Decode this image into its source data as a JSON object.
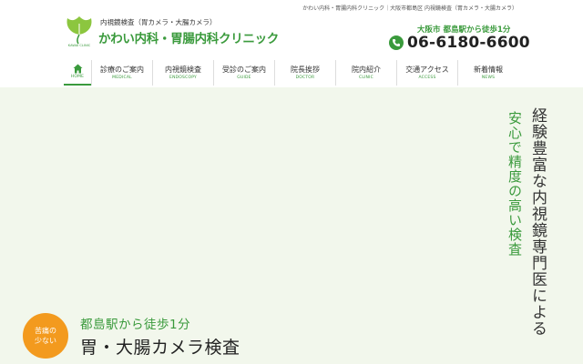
{
  "topbar": {
    "text": "かわい内科・胃腸内科クリニック｜大阪市都島区 内視鏡検査（胃カメラ・大腸カメラ）"
  },
  "header": {
    "logo_subtitle": "内視鏡検査（胃カメラ・大腸カメラ）",
    "logo_name": "かわい内科・胃腸内科クリニック",
    "logo_mark_text": "KAWAI CLINIC",
    "access_note": "大阪市 都島駅から徒歩1分",
    "phone": "06-6180-6600"
  },
  "nav": {
    "items": [
      {
        "label": "",
        "sub": "HOME",
        "icon": "home-icon"
      },
      {
        "label": "診療のご案内",
        "sub": "MEDICAL"
      },
      {
        "label": "内視鏡検査",
        "sub": "ENDOSCOPY"
      },
      {
        "label": "受診のご案内",
        "sub": "GUIDE"
      },
      {
        "label": "院長挨拶",
        "sub": "DOCTOR"
      },
      {
        "label": "院内紹介",
        "sub": "CLINIC"
      },
      {
        "label": "交通アクセス",
        "sub": "ACCESS"
      },
      {
        "label": "新着情報",
        "sub": "NEWS"
      }
    ]
  },
  "hero": {
    "vertical_green": "安心で精度の高い検査",
    "vertical_dark": "経験豊富な内視鏡専門医による",
    "badge_line1": "苦痛の",
    "badge_line2": "少ない",
    "subtitle": "都島駅から徒歩1分",
    "title": "胃・大腸カメラ検査"
  },
  "colors": {
    "brand_green": "#3a9a3c",
    "accent_orange": "#f39a1e",
    "hero_bg": "#f2f7ec"
  }
}
